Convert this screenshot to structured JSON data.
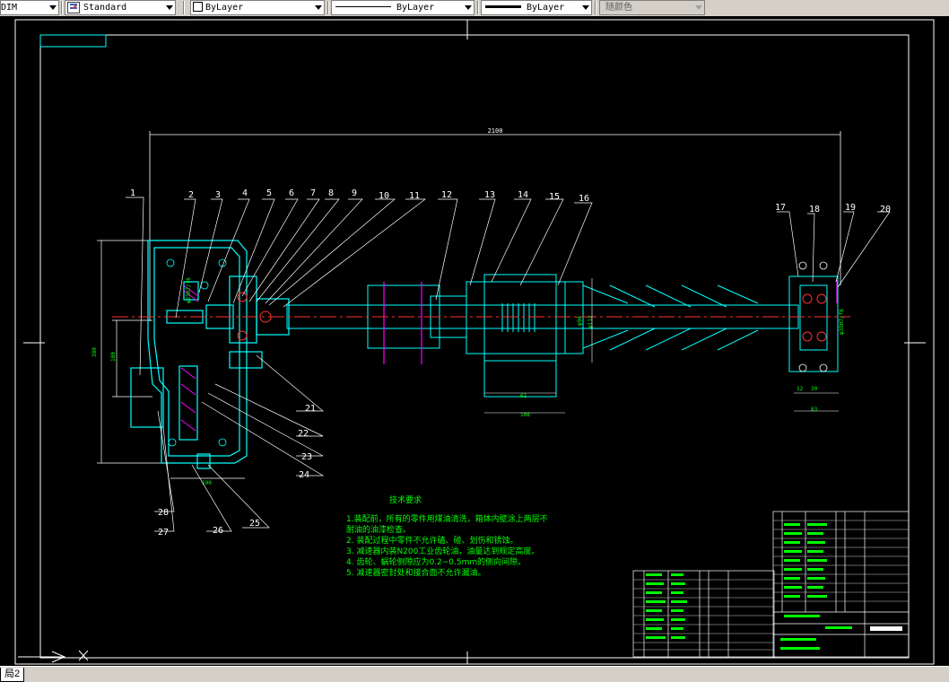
{
  "toolbar": {
    "dimstyle": "DIM",
    "textstyle": "Standard",
    "layer": "ByLayer",
    "linetype": "ByLayer",
    "lineweight": "ByLayer",
    "plotstyle": "随颜色"
  },
  "drawing": {
    "overall_dim": "2100",
    "callouts": [
      "1",
      "2",
      "3",
      "4",
      "5",
      "6",
      "7",
      "8",
      "9",
      "10",
      "11",
      "12",
      "13",
      "14",
      "15",
      "16",
      "17",
      "18",
      "19",
      "20",
      "21",
      "22",
      "23",
      "24",
      "25",
      "26",
      "27",
      "28"
    ],
    "tech_title": "技术要求",
    "tech_notes": [
      "1.装配前，所有的零件用煤油清洗，箱体内壁涂上两层不",
      "  耐油的油漆检查。",
      "2. 装配过程中零件不允许磕、碰、划伤和锈蚀。",
      "3. 减速器内装N200工业齿轮油，油量达到规定高度。",
      "4. 齿轮、蜗轮侧隙应为0.2~0.5mm的侧向间隙。",
      "5. 减速器密封处和接合面不允许漏油。"
    ]
  },
  "colors": {
    "background": "#000000",
    "frame": "#ffffff",
    "geometry": "#00ffff",
    "annotation": "#00ff00",
    "centerline": "#ff3030",
    "hatch": "#ff00ff",
    "leader": "#ffffff"
  },
  "status": {
    "layout_tab": "局2"
  }
}
